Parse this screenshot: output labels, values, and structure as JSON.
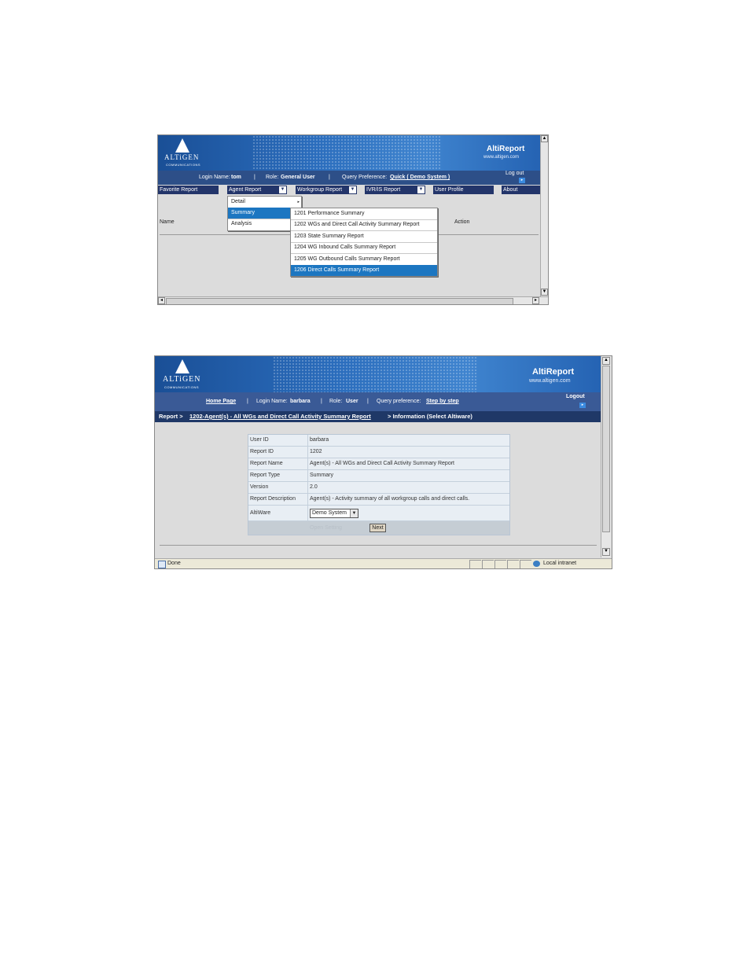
{
  "colors": {
    "banner_blue": "#2a6cbc",
    "nav_dark": "#23356a",
    "highlight": "#1c76c1",
    "crumb_bar": "#1f3867"
  },
  "shot1": {
    "logo": {
      "word": "ALTiGEN",
      "sub": "COMMUNICATIONS"
    },
    "brand": {
      "title": "AltiReport",
      "url": "www.altigen.com"
    },
    "nav": {
      "login_label": "Login Name:",
      "login_value": "tom",
      "role_label": "Role:",
      "role_value": "General User",
      "sep": "|",
      "query_label": "Query Preference:",
      "query_value": "Quick ( Demo System )",
      "logout": "Log out"
    },
    "menu": {
      "favorite": "Favorite Report",
      "agent": "Agent Report",
      "workgroup": "Workgroup Report",
      "ivr": "IVR/IS Report",
      "profile": "User Profile",
      "about": "About"
    },
    "submenu": [
      "Detail",
      "Summary",
      "Analysis"
    ],
    "reports": [
      "1201 Performance Summary",
      "1202 WGs and Direct Call Activity Summary Report",
      "1203 State Summary Report",
      "1204 WG Inbound Calls Summary Report",
      "1205 WG Outbound Calls Summary Report",
      "1206 Direct Calls Summary Report"
    ],
    "columns": {
      "name": "Name",
      "action": "Action"
    },
    "icons": {
      "dropdown": "dropdown-arrow-icon",
      "submenu": "submenu-arrow-icon",
      "logout": "logout-arrow-icon"
    }
  },
  "shot2": {
    "logo": {
      "word": "ALTiGEN",
      "sub": "COMMUNICATIONS"
    },
    "brand": {
      "title": "AltiReport",
      "url": "www.altigen.com"
    },
    "nav": {
      "home": "Home Page",
      "sep": "|",
      "login_label": "Login Name:",
      "login_value": "barbara",
      "role_label": "Role:",
      "role_value": "User",
      "query_label": "Query preference:",
      "query_value": "Step by step",
      "logout": "Logout"
    },
    "breadcrumb": {
      "root": "Report >",
      "link": "1202-Agent(s) - All WGs and Direct Call Activity Summary Report",
      "tail": "> Information (Select Altiware)"
    },
    "info": [
      {
        "key": "User ID",
        "value": "barbara"
      },
      {
        "key": "Report ID",
        "value": "1202"
      },
      {
        "key": "Report Name",
        "value": "Agent(s) - All WGs and Direct Call Activity Summary Report"
      },
      {
        "key": "Report Type",
        "value": "Summary"
      },
      {
        "key": "Version",
        "value": "2.0"
      },
      {
        "key": "Report Description",
        "value": "Agent(s) - Activity summary of all workgroup calls and direct calls."
      }
    ],
    "altiware": {
      "label": "AltiWare",
      "selected": "Demo System"
    },
    "ghost_button": "Open Setting",
    "next_button": "Next",
    "status": {
      "left": "Done",
      "zone": "Local intranet"
    }
  }
}
